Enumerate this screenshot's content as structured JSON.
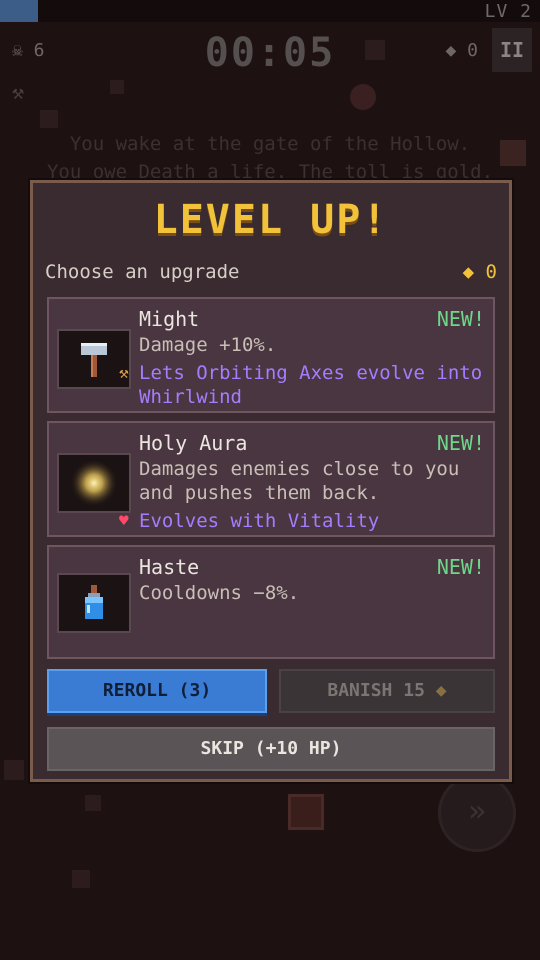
{
  "hud": {
    "xp_fraction": 0.07,
    "level": "LV 2",
    "kills": "☠ 6",
    "timer": "00:05",
    "gold": "◆ 0",
    "pause": "II"
  },
  "story": {
    "line1": "You wake at the gate of the Hollow.",
    "line2": "You owe Death a life. The toll is gold."
  },
  "modal": {
    "title": "LEVEL UP!",
    "prompt": "Choose an upgrade",
    "gold": "◆ 0",
    "cards": [
      {
        "icon": "hammer-icon",
        "name": "Might",
        "badge": "NEW!",
        "desc": "Damage +10%.",
        "evolve": "Lets Orbiting Axes evolve into Whirlwind",
        "evolve_icon": "axe-icon"
      },
      {
        "icon": "glow-orb-icon",
        "name": "Holy Aura",
        "badge": "NEW!",
        "desc": "Damages enemies close to you and pushes them back.",
        "evolve": "Evolves with Vitality",
        "evolve_icon": "heart-icon"
      },
      {
        "icon": "potion-icon",
        "name": "Haste",
        "badge": "NEW!",
        "desc": "Cooldowns −8%."
      }
    ],
    "reroll": "REROLL (3)",
    "banish": "BANISH 15",
    "skip": "SKIP (+10 HP)"
  },
  "fast_forward": "»",
  "colors": {
    "accent_gold": "#f2c23a",
    "new_badge": "#6fd68a",
    "evolve_text": "#a67cff",
    "reroll_blue": "#3a7bd4"
  }
}
